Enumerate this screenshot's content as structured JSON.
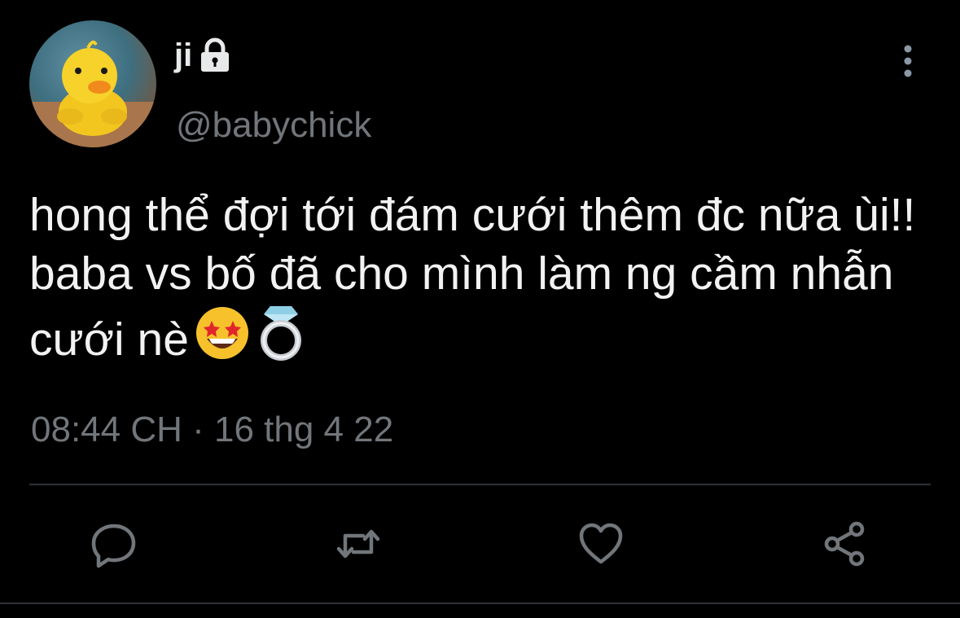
{
  "tweet": {
    "display_name": "ji",
    "handle": "@babychick",
    "text": "hong thể đợi tới đám cưới thêm đc nữa ùi!! baba vs bố đã cho mình làm ng cầm nhẫn cưới nè",
    "emojis": [
      "star-struck-emoji",
      "ring-emoji"
    ],
    "timestamp": "08:44 CH · 16 thg 4 22"
  },
  "icons": {
    "lock": "lock-icon",
    "more": "more-vertical-icon",
    "reply": "reply-icon",
    "retweet": "retweet-icon",
    "like": "heart-icon",
    "share": "share-icon"
  },
  "colors": {
    "background": "#000000",
    "text": "#e7e9ea",
    "secondary": "#71767b",
    "divider": "#2f3336"
  }
}
